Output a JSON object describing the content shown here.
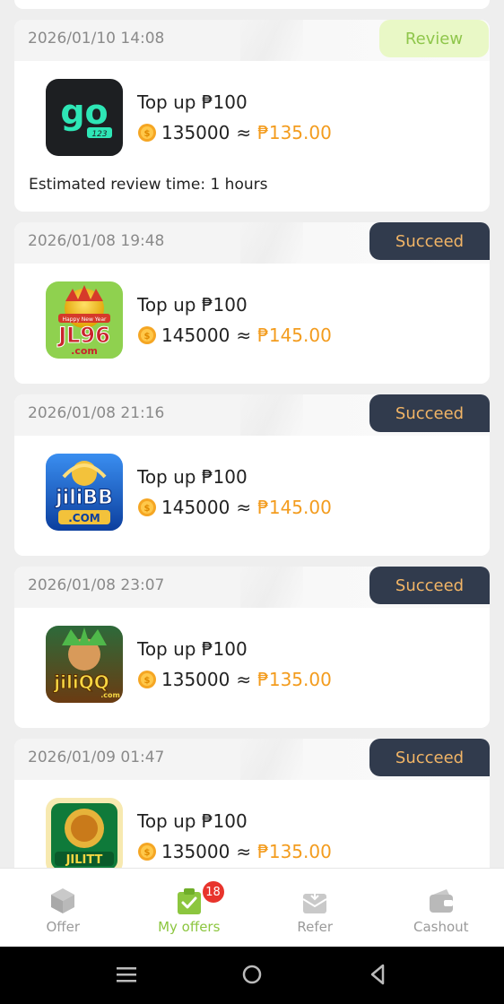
{
  "offers": [
    {
      "date": "2026/01/10 14:08",
      "status": "Review",
      "status_type": "review",
      "app": "go123",
      "title": "Top up ₱100",
      "coins": "135000",
      "approx": "≈",
      "amount": "₱135.00",
      "estimate": "Estimated review time: 1 hours"
    },
    {
      "date": "2026/01/08 19:48",
      "status": "Succeed",
      "status_type": "succeed",
      "app": "JL96",
      "title": "Top up ₱100",
      "coins": "145000",
      "approx": "≈",
      "amount": "₱145.00"
    },
    {
      "date": "2026/01/08 21:16",
      "status": "Succeed",
      "status_type": "succeed",
      "app": "jiliBB",
      "title": "Top up ₱100",
      "coins": "145000",
      "approx": "≈",
      "amount": "₱145.00"
    },
    {
      "date": "2026/01/08 23:07",
      "status": "Succeed",
      "status_type": "succeed",
      "app": "jiliQQ",
      "title": "Top up ₱100",
      "coins": "135000",
      "approx": "≈",
      "amount": "₱135.00"
    },
    {
      "date": "2026/01/09 01:47",
      "status": "Succeed",
      "status_type": "succeed",
      "app": "JILITT",
      "title": "Top up ₱100",
      "coins": "135000",
      "approx": "≈",
      "amount": "₱135.00"
    }
  ],
  "logo_text": {
    "go123_main": "go",
    "go123_sub": "123",
    "jl96_main": "JL96",
    "jl96_sub": ".com",
    "jl96_banner": "Happy New Year",
    "jilibb_main": "jiliBB",
    "jilibb_sub": ".COM",
    "jiliqq_main": "jiliQQ",
    "jiliqq_sub": ".com",
    "jilitt_main": "JILITT"
  },
  "tabs": [
    {
      "label": "Offer",
      "icon": "cube-icon",
      "active": false
    },
    {
      "label": "My offers",
      "icon": "clipboard-check-icon",
      "active": true,
      "badge": "18"
    },
    {
      "label": "Refer",
      "icon": "gift-box-icon",
      "active": false
    },
    {
      "label": "Cashout",
      "icon": "wallet-icon",
      "active": false
    }
  ],
  "colors": {
    "accent": "#8cc63f",
    "amount": "#f39c1e",
    "succeed_bg": "#313b4d",
    "succeed_text": "#f2b566",
    "review_bg": "#e9f8c6",
    "review_text": "#8fc64b",
    "badge": "#e8342c"
  }
}
